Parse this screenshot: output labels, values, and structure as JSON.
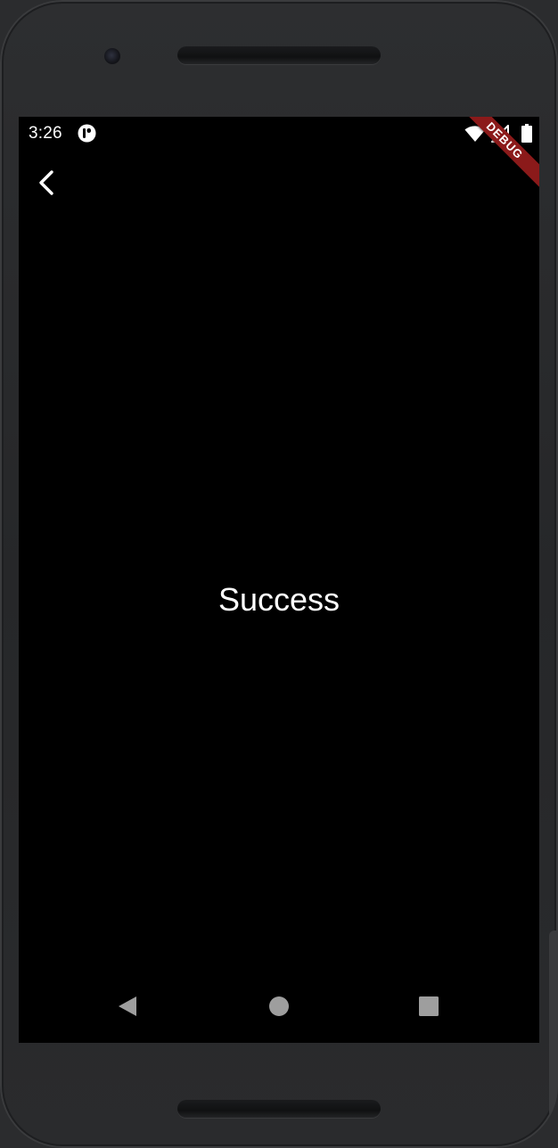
{
  "status_bar": {
    "time": "3:26",
    "notification_icon": "app-notification-icon",
    "wifi_icon": "wifi-icon",
    "signal_icon": "cell-signal-icon",
    "battery_icon": "battery-full-icon"
  },
  "debug_banner": {
    "label": "DEBUG",
    "color": "#8b1a1a"
  },
  "app_bar": {
    "back_icon": "chevron-left-icon"
  },
  "main": {
    "message": "Success"
  },
  "nav_bar": {
    "back_icon": "triangle-back-icon",
    "home_icon": "circle-home-icon",
    "recents_icon": "square-recents-icon"
  },
  "colors": {
    "screen_background": "#000000",
    "text": "#ffffff",
    "nav_icons": "#9e9e9e",
    "device_frame": "#2b2c2e"
  }
}
